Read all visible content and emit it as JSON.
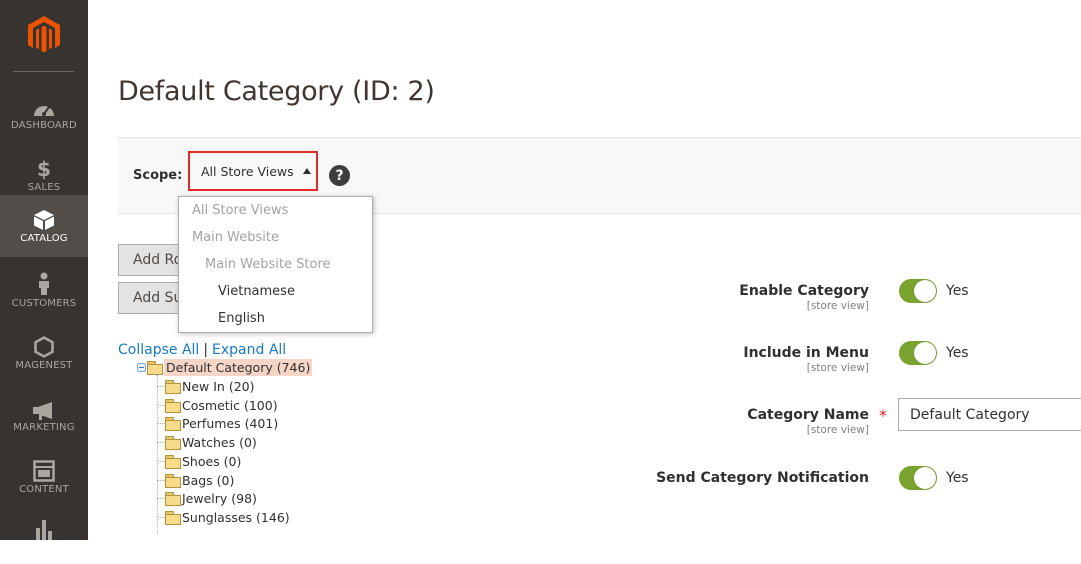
{
  "sidebar": {
    "logo": "magento-logo",
    "items": [
      {
        "label": "DASHBOARD",
        "icon": "speedometer-icon",
        "active": false
      },
      {
        "label": "SALES",
        "icon": "dollar-icon",
        "active": false
      },
      {
        "label": "CATALOG",
        "icon": "box-icon",
        "active": true
      },
      {
        "label": "CUSTOMERS",
        "icon": "person-icon",
        "active": false
      },
      {
        "label": "MAGENEST",
        "icon": "hexagon-icon",
        "active": false
      },
      {
        "label": "MARKETING",
        "icon": "megaphone-icon",
        "active": false
      },
      {
        "label": "CONTENT",
        "icon": "layout-icon",
        "active": false
      },
      {
        "label": "",
        "icon": "bar-chart-icon",
        "active": false
      }
    ]
  },
  "page": {
    "title": "Default Category (ID: 2)"
  },
  "scope": {
    "label": "Scope:",
    "selected": "All Store Views",
    "help_icon": "?",
    "options": [
      {
        "label": "All Store Views",
        "disabled": true
      },
      {
        "label": "Main Website",
        "disabled": true
      },
      {
        "label": "Main Website Store",
        "disabled": true
      },
      {
        "label": "Vietnamese",
        "disabled": false
      },
      {
        "label": "English",
        "disabled": false
      }
    ]
  },
  "buttons": {
    "add_root": "Add Root Category",
    "add_sub": "Add Subcategory"
  },
  "tree": {
    "collapse_all": "Collapse All",
    "separator": "|",
    "expand_all": "Expand All",
    "root": "Default Category (746)",
    "children": [
      "New In (20)",
      "Cosmetic (100)",
      "Perfumes (401)",
      "Watches (0)",
      "Shoes (0)",
      "Bags (0)",
      "Jewelry (98)",
      "Sunglasses (146)"
    ]
  },
  "form": {
    "enable_category": {
      "label": "Enable Category",
      "scope": "[store view]",
      "value": "Yes"
    },
    "include_in_menu": {
      "label": "Include in Menu",
      "scope": "[store view]",
      "value": "Yes"
    },
    "category_name": {
      "label": "Category Name",
      "scope": "[store view]",
      "required_mark": "*",
      "value": "Default Category"
    },
    "send_notification": {
      "label": "Send Category Notification",
      "value": "Yes"
    }
  },
  "colors": {
    "sidebar_bg": "#373330",
    "active_bg": "#524d49",
    "logo": "#eb5202",
    "highlight_border": "#e02b27",
    "toggle_on": "#79a22e",
    "link": "#1979c3"
  }
}
